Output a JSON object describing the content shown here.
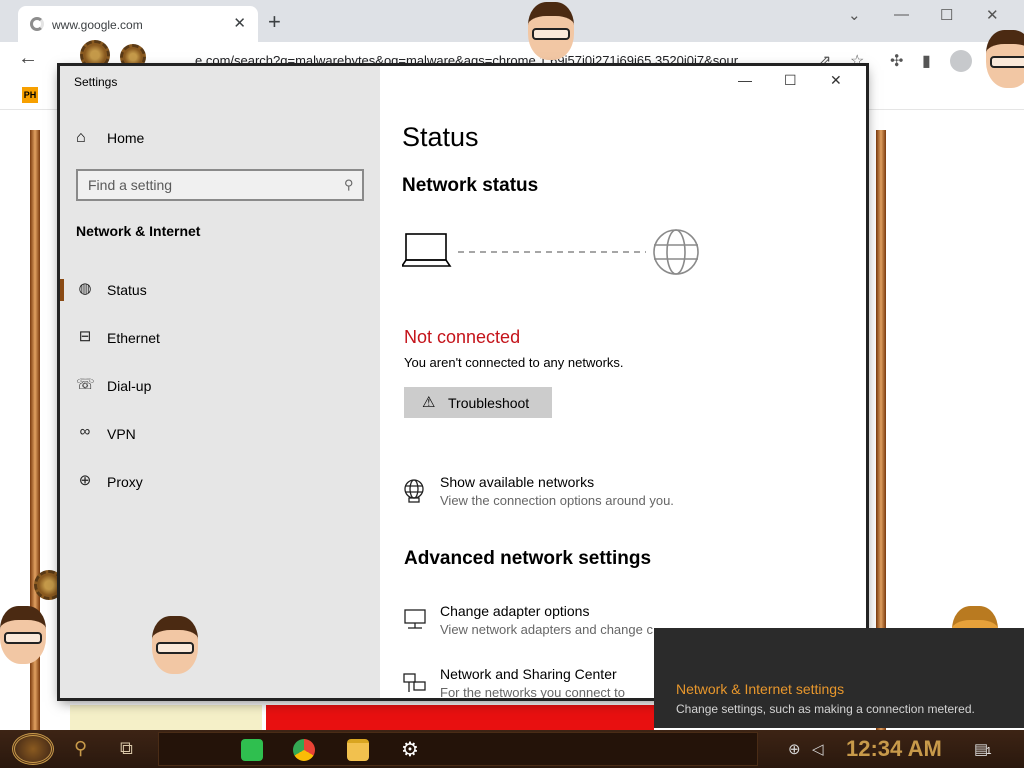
{
  "browser": {
    "tab_title": "www.google.com",
    "tab_close": "✕",
    "new_tab": "+",
    "omnibox": "e.com/search?q=malwarebytes&oq=malware&aqs=chrome.1.69i57j0i271j69i65.3520j0j7&sour",
    "bookmark_icon_text": "PH",
    "window_controls": [
      "⌄",
      "—",
      "☐",
      "✕"
    ]
  },
  "settings": {
    "window_title": "Settings",
    "home_label": "Home",
    "search": {
      "placeholder": "Find a setting"
    },
    "section_heading": "Network & Internet",
    "nav_items": [
      {
        "label": "Status",
        "icon": "globe-status-icon"
      },
      {
        "label": "Ethernet",
        "icon": "ethernet-icon"
      },
      {
        "label": "Dial-up",
        "icon": "dialup-icon"
      },
      {
        "label": "VPN",
        "icon": "vpn-icon"
      },
      {
        "label": "Proxy",
        "icon": "globe-icon"
      }
    ],
    "window_controls": [
      "—",
      "☐",
      "✕"
    ],
    "main": {
      "title": "Status",
      "network_status_heading": "Network status",
      "connection_state": "Not connected",
      "connection_desc": "You aren't connected to any networks.",
      "troubleshoot_label": "Troubleshoot",
      "show_networks": {
        "title": "Show available networks",
        "subtitle": "View the connection options around you."
      },
      "advanced_heading": "Advanced network settings",
      "change_adapter": {
        "title": "Change adapter options",
        "subtitle": "View network adapters and change c"
      },
      "sharing_center": {
        "title": "Network and Sharing Center",
        "subtitle": "For the networks you connect to"
      }
    }
  },
  "toast": {
    "title": "Network & Internet settings",
    "description": "Change settings, such as making a connection metered."
  },
  "taskbar": {
    "clock": "12:34 AM",
    "notification_count": "1"
  },
  "colors": {
    "accent_error": "#c4131a",
    "toast_accent": "#e8972c",
    "clock_color": "#c89a4a"
  }
}
